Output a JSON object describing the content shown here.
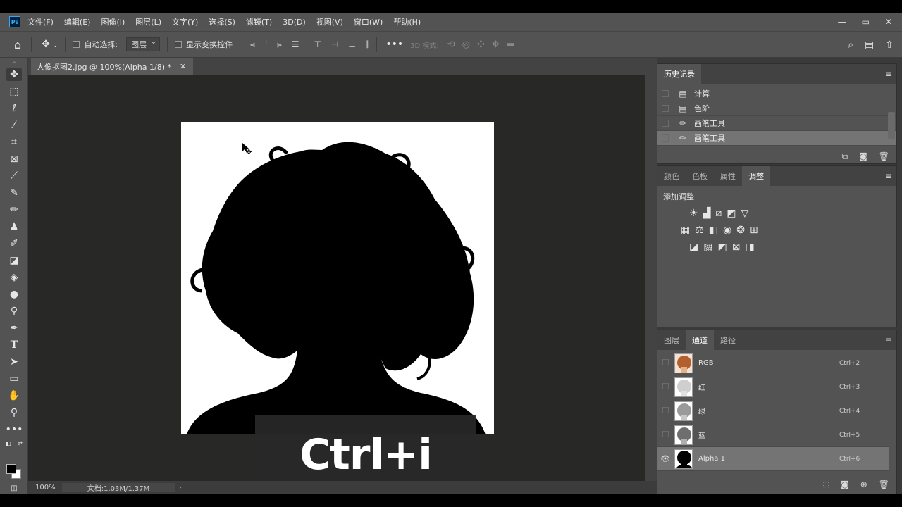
{
  "app": {
    "logo": "Ps",
    "menus": [
      "文件(F)",
      "编辑(E)",
      "图像(I)",
      "图层(L)",
      "文字(Y)",
      "选择(S)",
      "滤镜(T)",
      "3D(D)",
      "视图(V)",
      "窗口(W)",
      "帮助(H)"
    ],
    "window_controls": [
      "minimize",
      "maximize",
      "close"
    ]
  },
  "options_bar": {
    "auto_select_label": "自动选择:",
    "auto_select_value": "图层",
    "show_transform_label": "显示变换控件",
    "mode_3d_label": "3D 模式:"
  },
  "tools": [
    "move-tool",
    "marquee-tool",
    "lasso-tool",
    "magic-wand-tool",
    "crop-tool",
    "frame-tool",
    "eyedropper-tool",
    "healing-brush-tool",
    "brush-tool",
    "clone-stamp-tool",
    "history-brush-tool",
    "eraser-tool",
    "paint-bucket-tool",
    "blur-tool",
    "dodge-tool",
    "pen-tool",
    "type-tool",
    "path-selection-tool",
    "rectangle-tool",
    "hand-tool",
    "zoom-tool",
    "more-tools"
  ],
  "colors": {
    "foreground": "#000000",
    "background": "#ffffff",
    "accent": "#31a8ff"
  },
  "document": {
    "tab_title": "人像抠图2.jpg @ 100%(Alpha 1/8) *",
    "zoom": "100%",
    "doc_info": "文档:1.03M/1.37M",
    "shortcut_overlay": "Ctrl+i"
  },
  "history_panel": {
    "tab": "历史记录",
    "items": [
      {
        "label": "计算",
        "icon": "document-icon",
        "selected": false
      },
      {
        "label": "色阶",
        "icon": "document-icon",
        "selected": false
      },
      {
        "label": "画笔工具",
        "icon": "brush-icon",
        "selected": false
      },
      {
        "label": "画笔工具",
        "icon": "brush-icon",
        "selected": true
      }
    ]
  },
  "adjustments_panel": {
    "tabs": [
      "颜色",
      "色板",
      "属性",
      "调整"
    ],
    "active_tab": "调整",
    "title": "添加调整"
  },
  "channels_panel": {
    "tabs": [
      "图层",
      "通道",
      "路径"
    ],
    "active_tab": "通道",
    "channels": [
      {
        "name": "RGB",
        "shortcut": "Ctrl+2",
        "visible": false,
        "selected": false
      },
      {
        "name": "红",
        "shortcut": "Ctrl+3",
        "visible": false,
        "selected": false
      },
      {
        "name": "绿",
        "shortcut": "Ctrl+4",
        "visible": false,
        "selected": false
      },
      {
        "name": "蓝",
        "shortcut": "Ctrl+5",
        "visible": false,
        "selected": false
      },
      {
        "name": "Alpha 1",
        "shortcut": "Ctrl+6",
        "visible": true,
        "selected": true
      }
    ]
  }
}
